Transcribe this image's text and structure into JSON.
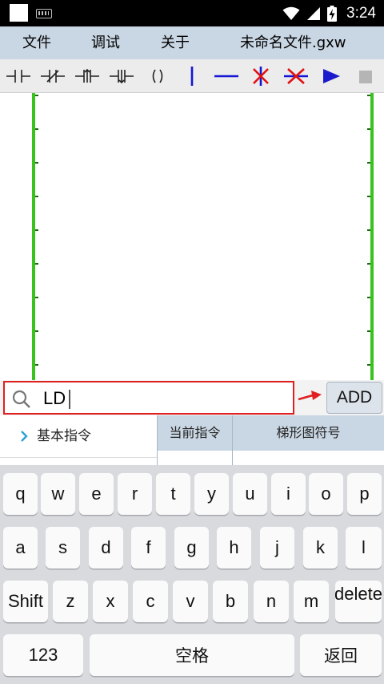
{
  "status_bar": {
    "time": "3:24",
    "icons": [
      "white-square-icon",
      "keyboard-icon",
      "wifi-icon",
      "signal-icon",
      "battery-charging-icon"
    ]
  },
  "menu": {
    "file": "文件",
    "debug": "调试",
    "about": "关于",
    "filename": "未命名文件.gxw"
  },
  "toolbar": {
    "tools": [
      "normally-open-contact-icon",
      "normally-closed-contact-icon",
      "rising-edge-contact-icon",
      "falling-edge-contact-icon",
      "output-coil-icon",
      "vertical-line-icon",
      "horizontal-line-icon",
      "delete-vertical-line-icon",
      "delete-horizontal-line-icon",
      "run-icon",
      "stop-icon"
    ],
    "colors": {
      "line": "#1515d6",
      "delete": "#e01010",
      "run": "#1a1acc",
      "stop": "#b5b5b5"
    }
  },
  "ladder": {
    "rail_color": "#39c21e"
  },
  "instruction_input": {
    "value": "LD",
    "add_label": "ADD"
  },
  "lists": {
    "basic_instructions": "基本指令",
    "current_instruction_header": "当前指令",
    "ladder_symbol_header": "梯形图符号"
  },
  "keyboard": {
    "row1": [
      "q",
      "w",
      "e",
      "r",
      "t",
      "y",
      "u",
      "i",
      "o",
      "p"
    ],
    "row2": [
      "a",
      "s",
      "d",
      "f",
      "g",
      "h",
      "j",
      "k",
      "l"
    ],
    "row3": [
      "Shift",
      "z",
      "x",
      "c",
      "v",
      "b",
      "n",
      "m",
      "delete"
    ],
    "row4": [
      "123",
      "空格",
      "返回"
    ]
  }
}
